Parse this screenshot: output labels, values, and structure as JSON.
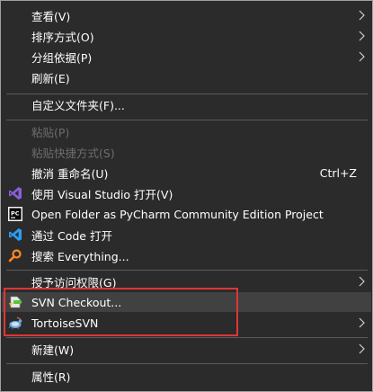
{
  "menu": {
    "view": "查看(V)",
    "sort": "排序方式(O)",
    "group": "分组依据(P)",
    "refresh": "刷新(E)",
    "customize": "自定义文件夹(F)...",
    "paste": "粘贴(P)",
    "paste_shortcut": "粘贴快捷方式(S)",
    "undo": "撤消 重命名(U)",
    "undo_shortcut": "Ctrl+Z",
    "open_vs": "使用 Visual Studio 打开(V)",
    "open_pycharm": "Open Folder as PyCharm Community Edition Project",
    "open_vscode": "通过 Code 打开",
    "search_everything": "搜索 Everything...",
    "grant_access": "授予访问权限(G)",
    "svn_checkout": "SVN Checkout...",
    "tortoise_svn": "TortoiseSVN",
    "new": "新建(W)",
    "properties": "属性(R)"
  },
  "icons": {
    "vs": "visual-studio-icon",
    "pycharm": "pycharm-icon",
    "vscode": "vscode-icon",
    "everything": "search-everything-icon",
    "svn_checkout": "svn-checkout-icon",
    "tortoise": "tortoise-svn-icon"
  },
  "colors": {
    "background": "#2b2b2b",
    "hover": "#414141",
    "disabled_text": "#6d6d6d",
    "highlight_box": "#e03535"
  }
}
